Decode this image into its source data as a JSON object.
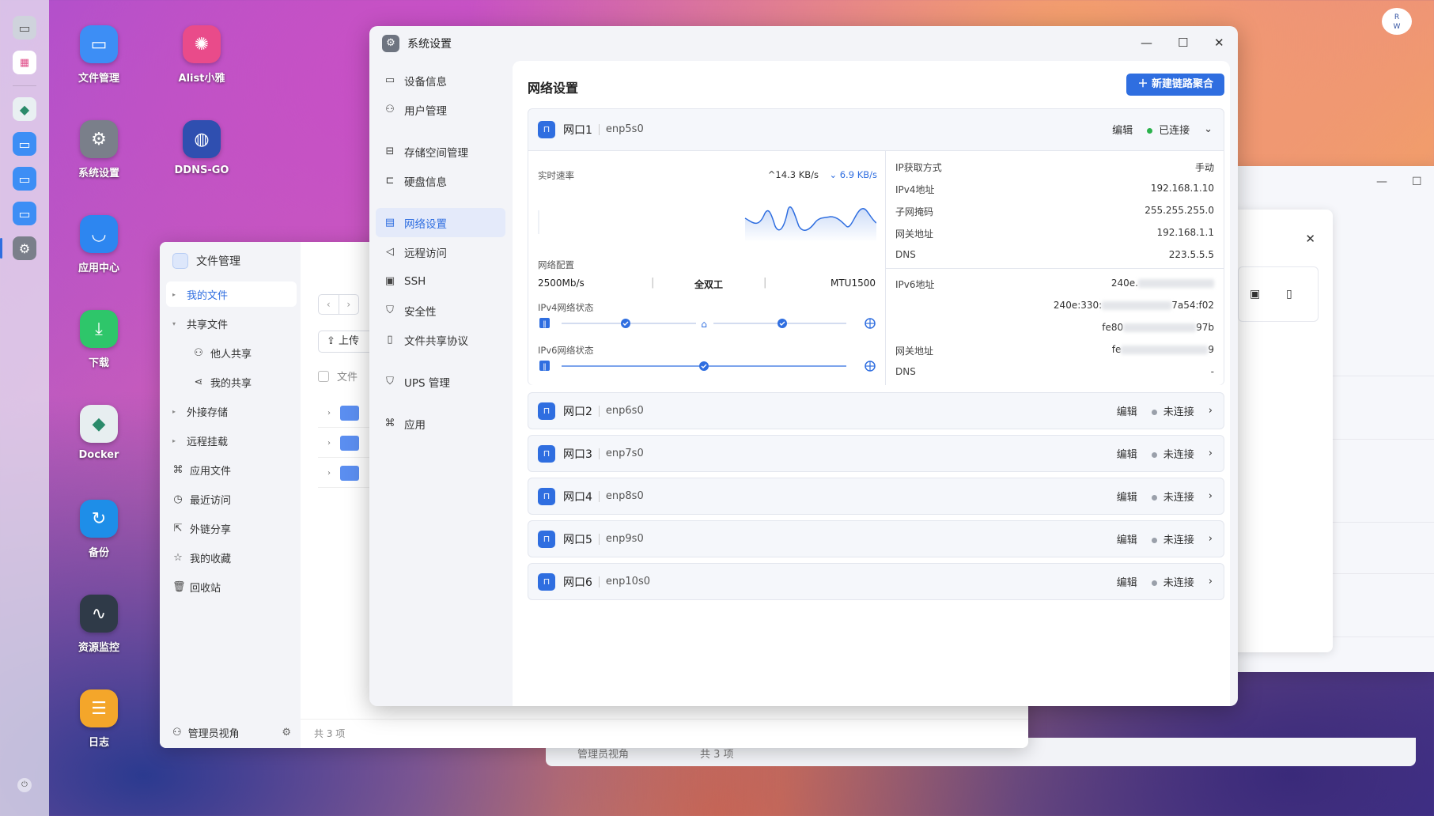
{
  "dock": {
    "items": [
      {
        "name": "monitor-icon"
      },
      {
        "name": "apps-grid-icon"
      },
      {
        "name": "docker-icon"
      },
      {
        "name": "folder-icon"
      },
      {
        "name": "folder-settings-icon"
      },
      {
        "name": "folder-icon-2"
      },
      {
        "name": "settings-icon"
      }
    ]
  },
  "desktop_icons": [
    {
      "label": "文件管理",
      "color": "#3d8ef5",
      "glyph": "▭"
    },
    {
      "label": "Alist小雅",
      "color": "#e94b8a",
      "glyph": "✺"
    },
    {
      "label": "系统设置",
      "color": "#7a7f8a",
      "glyph": "⚙"
    },
    {
      "label": "DDNS-GO",
      "color": "#2f4fb0",
      "glyph": "◍"
    },
    {
      "label": "应用中心",
      "color": "#2d86f0",
      "glyph": "◡"
    },
    {
      "label": "下载",
      "color": "#2ec66a",
      "glyph": "⤓"
    },
    {
      "label": "Docker",
      "color": "#e7eef0",
      "glyph": "◆"
    },
    {
      "label": "备份",
      "color": "#1e8ee8",
      "glyph": "↻"
    },
    {
      "label": "资源监控",
      "color": "#2f3a48",
      "glyph": "∿"
    },
    {
      "label": "日志",
      "color": "#f4a62a",
      "glyph": "☰"
    }
  ],
  "user_badge": {
    "line1": "R",
    "line2": "W"
  },
  "file_manager": {
    "title": "文件管理",
    "nav": [
      {
        "label": "我的文件",
        "glyph": "",
        "caret": "▸",
        "active": true
      },
      {
        "label": "共享文件",
        "glyph": "",
        "caret": "▾"
      },
      {
        "label": "他人共享",
        "glyph": "⚇",
        "sub": true
      },
      {
        "label": "我的共享",
        "glyph": "⋖",
        "sub": true
      },
      {
        "label": "外接存储",
        "glyph": "",
        "caret": "▸"
      },
      {
        "label": "远程挂载",
        "glyph": "",
        "caret": "▸"
      },
      {
        "label": "应用文件",
        "glyph": "⌘"
      },
      {
        "label": "最近访问",
        "glyph": "◷"
      },
      {
        "label": "外链分享",
        "glyph": "⇱"
      },
      {
        "label": "我的收藏",
        "glyph": "☆"
      },
      {
        "label": "回收站",
        "glyph": "🗑"
      }
    ],
    "upload_label": "上传",
    "file_col_header": "文件",
    "admin_view": "管理员视角",
    "status": "共 3 项"
  },
  "bg_footer": {
    "admin_view": "管理员视角",
    "status": "共 3 项"
  },
  "settings": {
    "title": "系统设置",
    "nav": [
      {
        "label": "设备信息",
        "glyph": "▭"
      },
      {
        "label": "用户管理",
        "glyph": "⚇"
      },
      {
        "gap": true
      },
      {
        "label": "存储空间管理",
        "glyph": "⊟"
      },
      {
        "label": "硬盘信息",
        "glyph": "⊏"
      },
      {
        "gap": true
      },
      {
        "label": "网络设置",
        "glyph": "▤",
        "active": true
      },
      {
        "label": "远程访问",
        "glyph": "◁"
      },
      {
        "label": "SSH",
        "glyph": "▣"
      },
      {
        "label": "安全性",
        "glyph": "⛉"
      },
      {
        "label": "文件共享协议",
        "glyph": "▯"
      },
      {
        "gap": true
      },
      {
        "label": "UPS 管理",
        "glyph": "⛉"
      },
      {
        "gap": true
      },
      {
        "label": "应用",
        "glyph": "⌘"
      }
    ],
    "heading": "网络设置",
    "new_bond_button": "＋  新建链路聚合",
    "edit_label": "编辑",
    "ports": [
      {
        "name": "网口1",
        "dev": "enp5s0",
        "status": "已连接",
        "connected": true,
        "expanded": true
      },
      {
        "name": "网口2",
        "dev": "enp6s0",
        "status": "未连接"
      },
      {
        "name": "网口3",
        "dev": "enp7s0",
        "status": "未连接"
      },
      {
        "name": "网口4",
        "dev": "enp8s0",
        "status": "未连接"
      },
      {
        "name": "网口5",
        "dev": "enp9s0",
        "status": "未连接"
      },
      {
        "name": "网口6",
        "dev": "enp10s0",
        "status": "未连接"
      }
    ],
    "port1": {
      "realtime_label": "实时速率",
      "upload_rate": "^14.3 KB/s",
      "download_rate": "⌄ 6.9 KB/s",
      "net_config_label": "网络配置",
      "speed": "2500Mb/s",
      "duplex": "全双工",
      "mtu": "MTU1500",
      "ipv4_status_label": "IPv4网络状态",
      "ipv6_status_label": "IPv6网络状态",
      "ip_method_label": "IP获取方式",
      "ip_method": "手动",
      "ipv4_label": "IPv4地址",
      "ipv4": "192.168.1.10",
      "mask_label": "子网掩码",
      "mask": "255.255.255.0",
      "gateway_label": "网关地址",
      "gateway": "192.168.1.1",
      "dns_label": "DNS",
      "dns": "223.5.5.5",
      "ipv6_label": "IPv6地址",
      "ipv6_1": "240e.",
      "ipv6_2": "240e:330:",
      "ipv6_2_tail": "7a54:f02",
      "ipv6_3": "fe80",
      "ipv6_3_tail": "97b",
      "ipv6_gateway_label": "网关地址",
      "ipv6_gateway": "fe",
      "ipv6_gateway_tail": "9",
      "ipv6_dns_label": "DNS",
      "ipv6_dns": "-"
    },
    "colors": {
      "accent": "#2f6ee0",
      "connected": "#2bb24c",
      "disconnected": "#9aa0aa"
    }
  }
}
